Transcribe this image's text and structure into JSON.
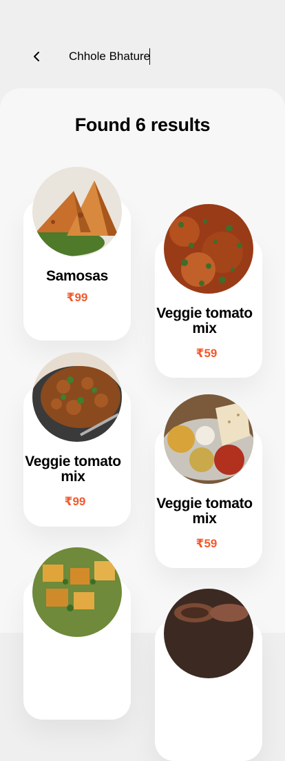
{
  "search": {
    "value": "Chhole Bhature"
  },
  "results": {
    "title": "Found  6 results"
  },
  "items": [
    {
      "name": "Samosas",
      "price": "₹99",
      "image": "samosa-photo"
    },
    {
      "name": "Veggie tomato mix",
      "price": "₹59",
      "image": "curry-photo"
    },
    {
      "name": "Veggie tomato mix",
      "price": "₹99",
      "image": "stir-fry-photo"
    },
    {
      "name": "Veggie tomato mix",
      "price": "₹59",
      "image": "thali-photo"
    },
    {
      "name": "",
      "price": "",
      "image": "paneer-tikka-photo"
    },
    {
      "name": "",
      "price": "",
      "image": "clay-pots-photo"
    }
  ],
  "colors": {
    "price": "#f2592a",
    "background": "#efefef",
    "card": "#ffffff"
  }
}
